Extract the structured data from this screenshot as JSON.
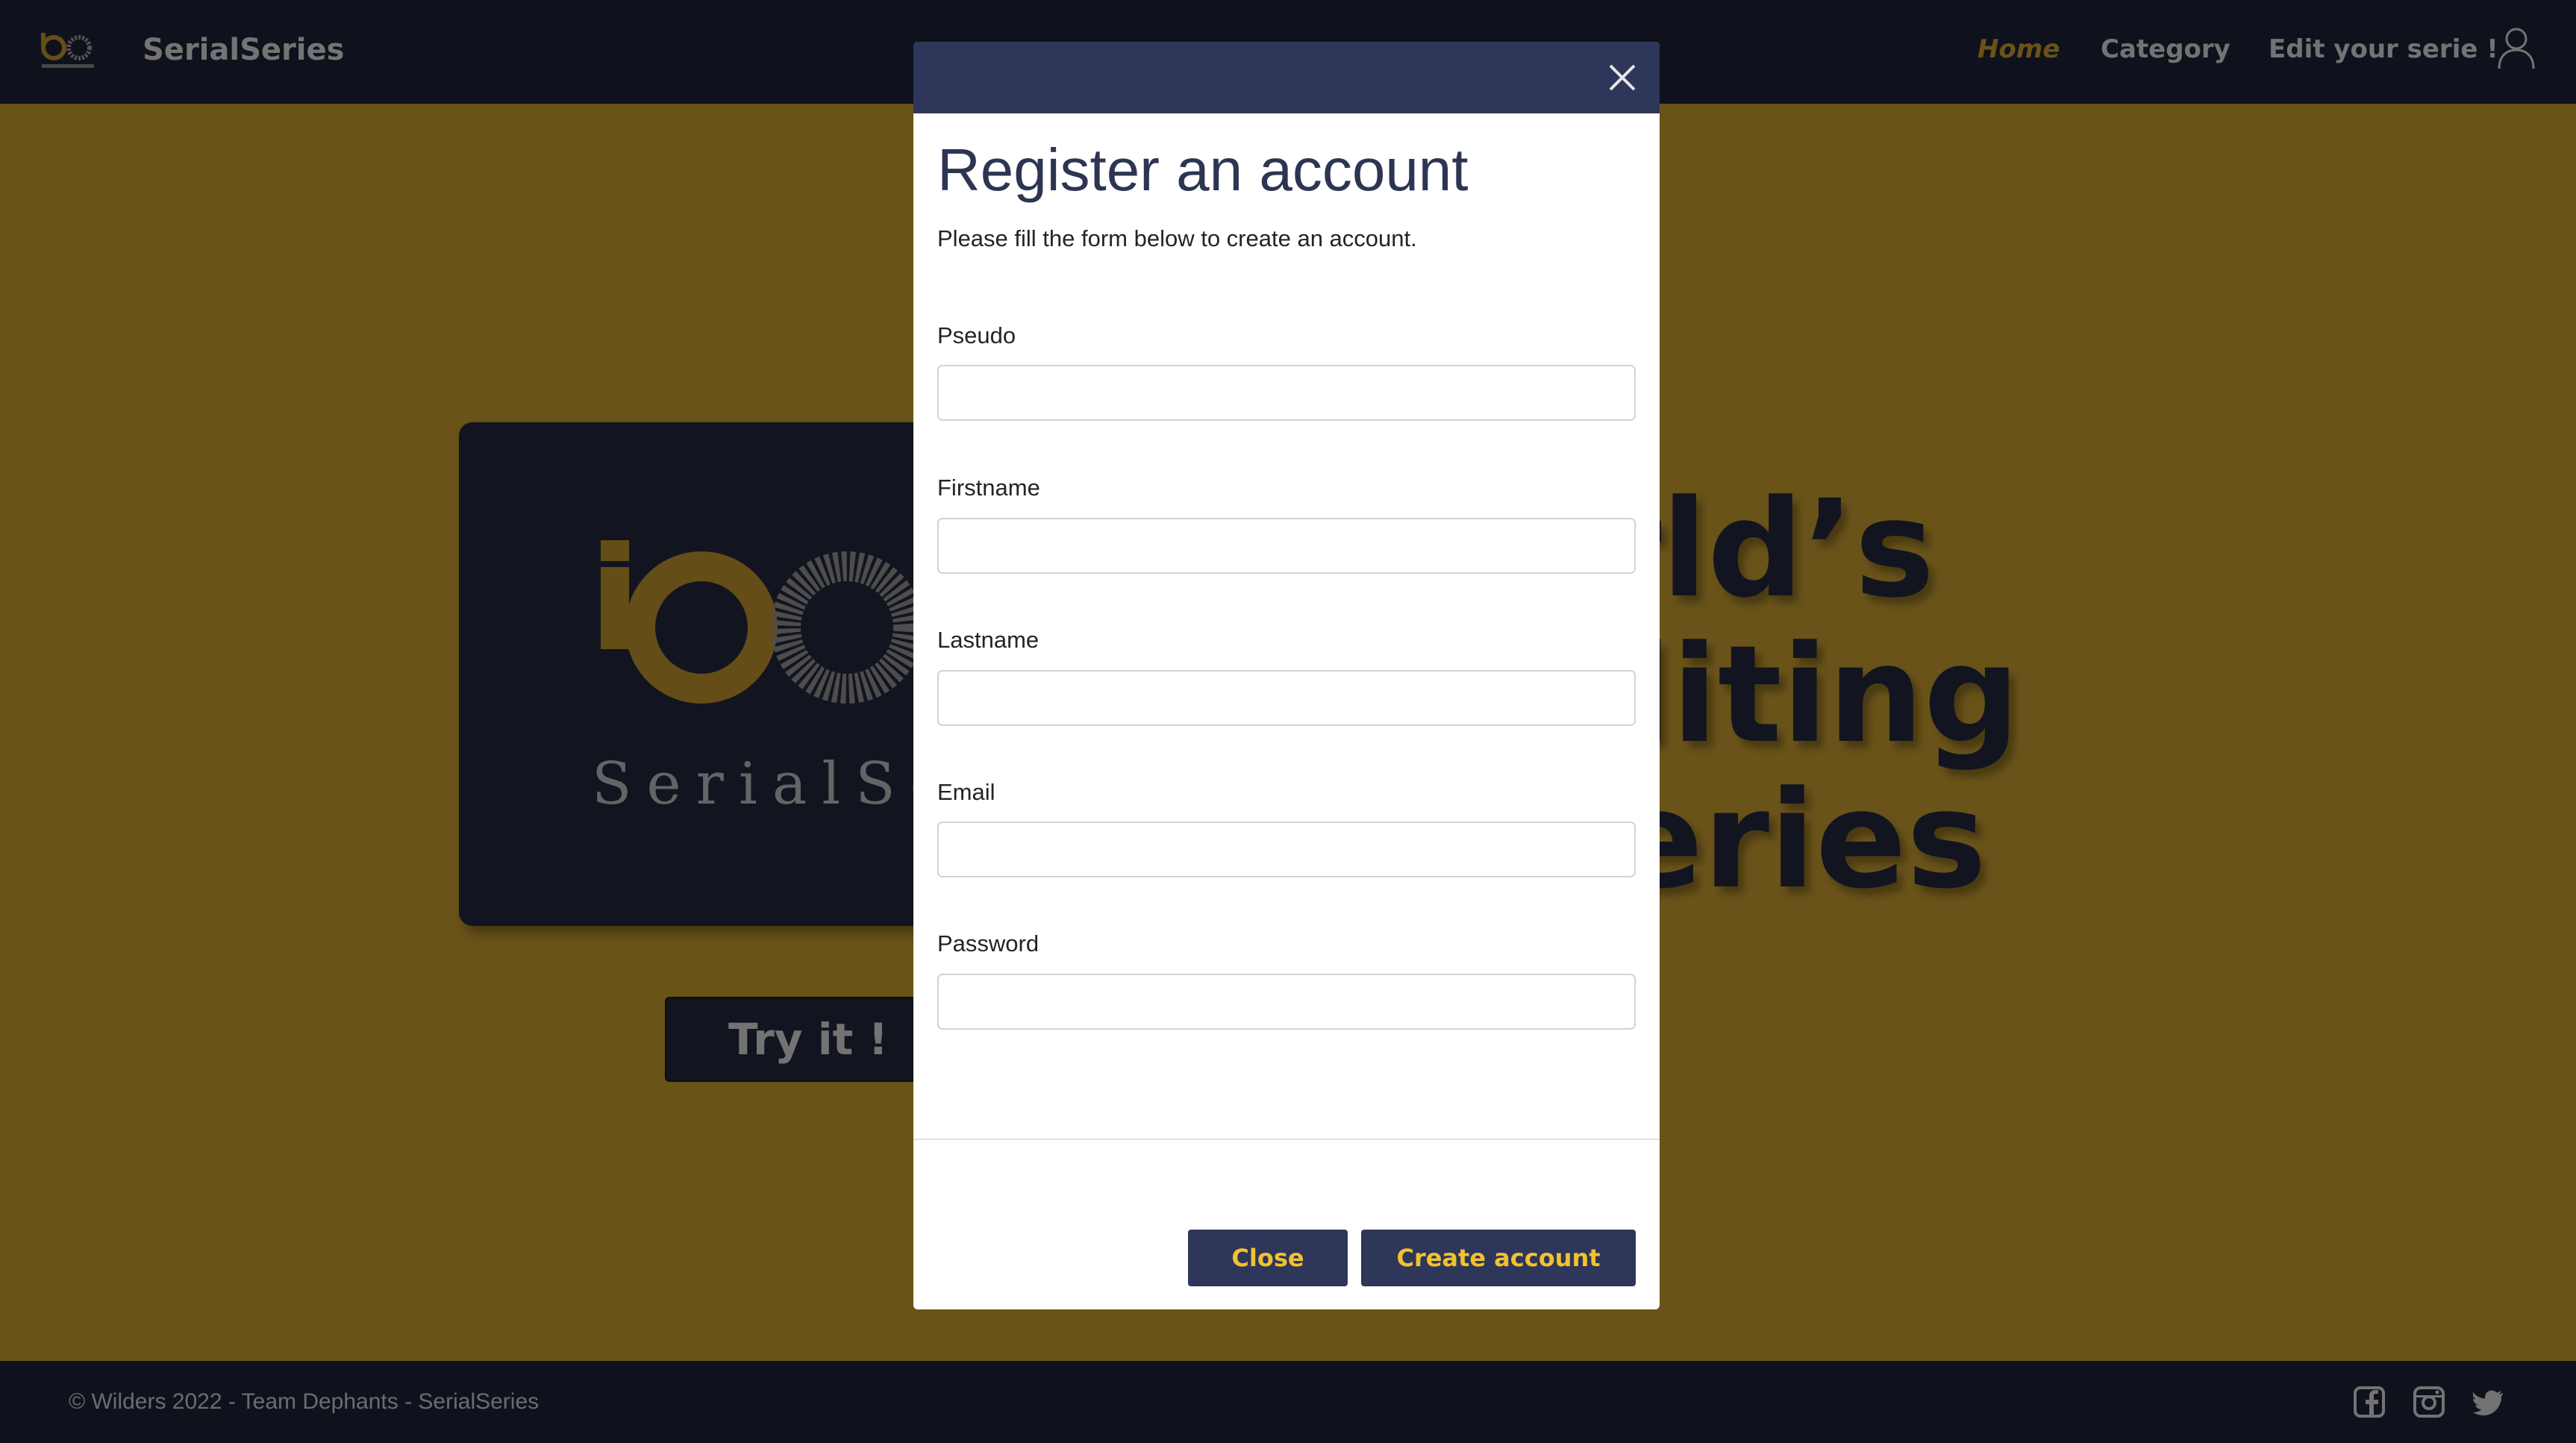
{
  "navbar": {
    "brand": "SerialSeries",
    "links": [
      {
        "label": "Home",
        "active": true
      },
      {
        "label": "Category",
        "active": false
      },
      {
        "label": "Edit your serie !",
        "active": false
      }
    ],
    "user_icon": "user-icon",
    "logo_icon": "infinity-logo-icon"
  },
  "hero": {
    "card_logo_text": "SerialSeries",
    "try_button": "Try it !",
    "lines": [
      "world’s",
      "st editing",
      "or series"
    ]
  },
  "footer": {
    "copyright": "© Wilders 2022 - Team Dephants - SerialSeries",
    "social": [
      "facebook-icon",
      "instagram-icon",
      "twitter-icon"
    ]
  },
  "modal": {
    "title": "Register an account",
    "subtitle": "Please fill the form below to create an account.",
    "fields": [
      {
        "label": "Pseudo",
        "value": ""
      },
      {
        "label": "Firstname",
        "value": ""
      },
      {
        "label": "Lastname",
        "value": ""
      },
      {
        "label": "Email",
        "value": ""
      },
      {
        "label": "Password",
        "value": ""
      }
    ],
    "close_button": "Close",
    "create_button": "Create account"
  },
  "colors": {
    "navy": "#1f2438",
    "gold": "#d4a733",
    "modal_header": "#2e365a",
    "button_text": "#f2c22e"
  }
}
